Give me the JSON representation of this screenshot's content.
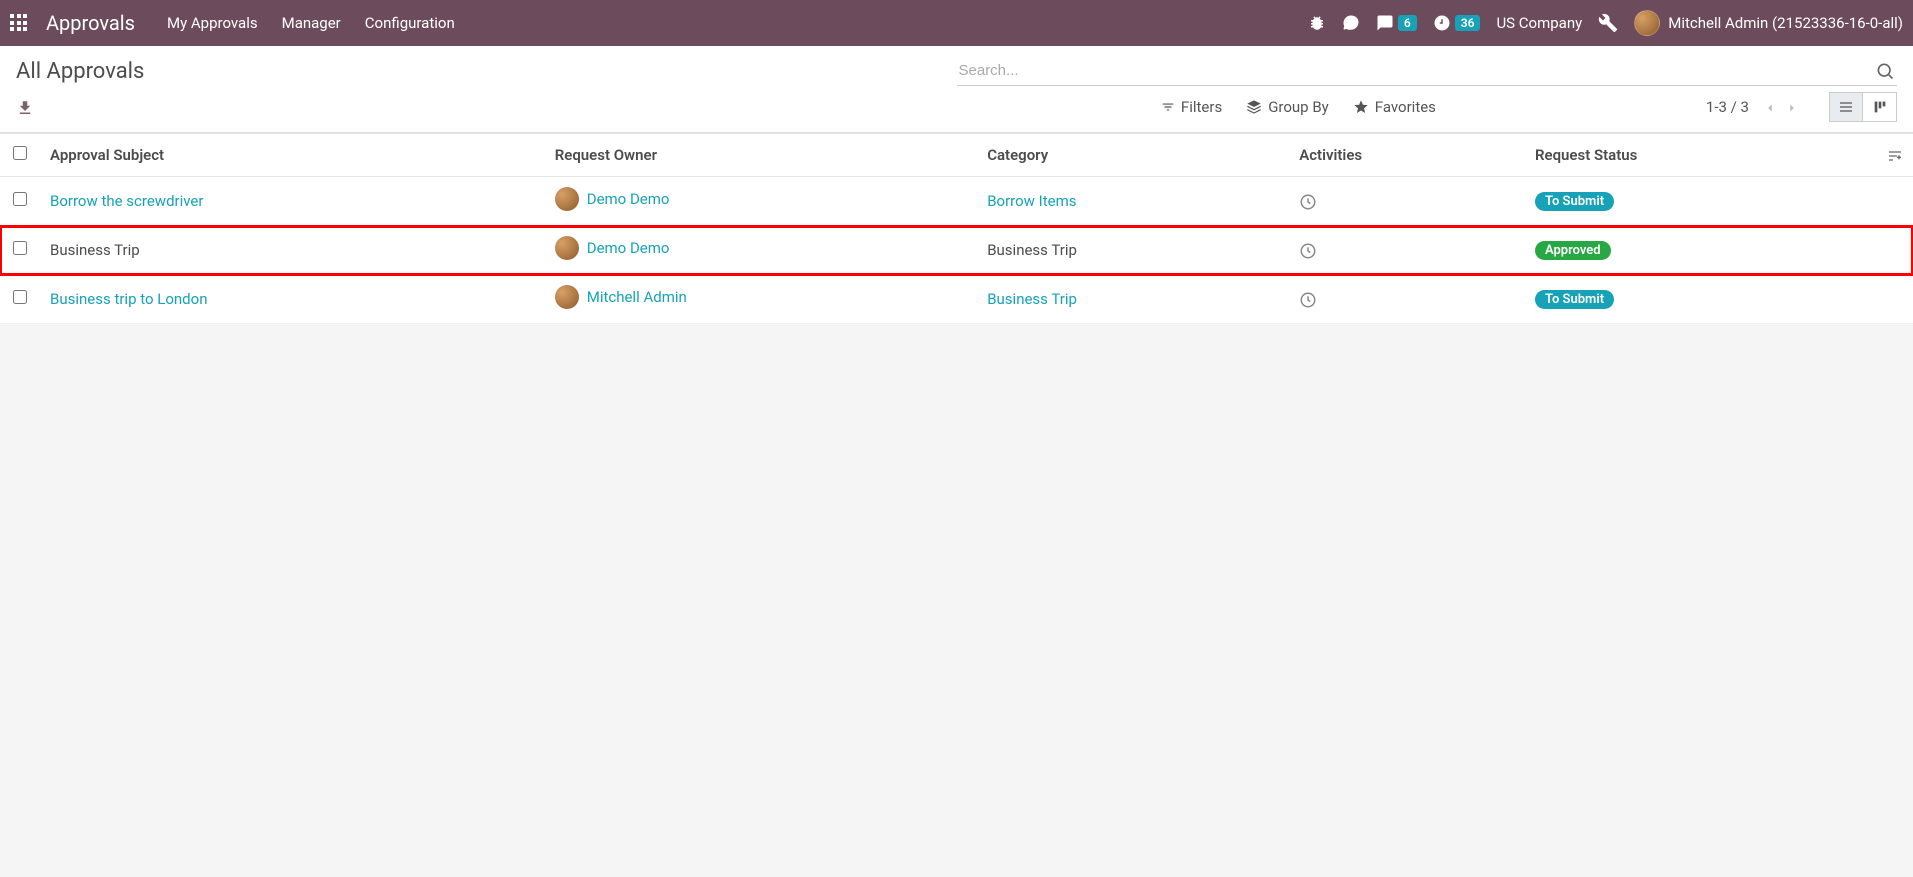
{
  "topnav": {
    "app_title": "Approvals",
    "links": [
      "My Approvals",
      "Manager",
      "Configuration"
    ],
    "chat_badge": "6",
    "clock_badge": "36",
    "company": "US Company",
    "user_name": "Mitchell Admin (21523336-16-0-all)"
  },
  "control_panel": {
    "title": "All Approvals",
    "search_placeholder": "Search...",
    "filters_label": "Filters",
    "groupby_label": "Group By",
    "favorites_label": "Favorites",
    "pager": "1-3 / 3"
  },
  "table": {
    "headers": {
      "subject": "Approval Subject",
      "owner": "Request Owner",
      "category": "Category",
      "activities": "Activities",
      "status": "Request Status"
    },
    "rows": [
      {
        "subject": "Borrow the screwdriver",
        "subject_link": true,
        "owner": "Demo Demo",
        "category": "Borrow Items",
        "category_link": true,
        "status": "To Submit",
        "status_class": "status-tosubmit",
        "highlighted": false
      },
      {
        "subject": "Business Trip",
        "subject_link": false,
        "owner": "Demo Demo",
        "category": "Business Trip",
        "category_link": false,
        "status": "Approved",
        "status_class": "status-approved",
        "highlighted": true
      },
      {
        "subject": "Business trip to London",
        "subject_link": true,
        "owner": "Mitchell Admin",
        "category": "Business Trip",
        "category_link": true,
        "status": "To Submit",
        "status_class": "status-tosubmit",
        "highlighted": false
      }
    ]
  }
}
